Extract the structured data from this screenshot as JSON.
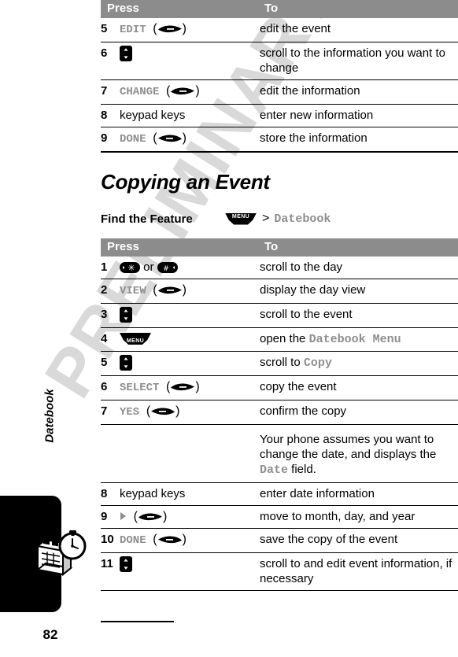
{
  "watermark": {
    "text": "PRELIMINARY",
    "color": "#d9d9d9"
  },
  "sidebar": {
    "chapter_label": "Datebook",
    "tab_icon": "datebook-stopwatch-icon",
    "page_number": "82"
  },
  "table_top": {
    "columns": [
      "Press",
      "To"
    ],
    "rows": [
      {
        "num": "5",
        "press_label": "EDIT",
        "press_key": "right-soft-key",
        "to": "edit the event"
      },
      {
        "num": "6",
        "press_label": "",
        "press_key": "scroll-key",
        "to": "scroll to the information you want to change"
      },
      {
        "num": "7",
        "press_label": "CHANGE",
        "press_key": "right-soft-key",
        "to": "edit the information"
      },
      {
        "num": "8",
        "press_label": "keypad keys",
        "press_key": "none",
        "to": "enter new information"
      },
      {
        "num": "9",
        "press_label": "DONE",
        "press_key": "left-soft-key",
        "to": "store the information"
      }
    ]
  },
  "section": {
    "heading": "Copying an Event",
    "find_the_feature": {
      "label": "Find the Feature",
      "key": "MENU",
      "separator": ">",
      "path": "Datebook"
    }
  },
  "table_main": {
    "columns": [
      "Press",
      "To"
    ],
    "rows": [
      {
        "num": "1",
        "press_label": "",
        "press_key": "star-key-or-pound-key",
        "or_text": "or",
        "to": "scroll to the day"
      },
      {
        "num": "2",
        "press_label": "VIEW",
        "press_key": "right-soft-key",
        "to": "display the day view"
      },
      {
        "num": "3",
        "press_label": "",
        "press_key": "scroll-key",
        "to": "scroll to the event"
      },
      {
        "num": "4",
        "press_label": "",
        "press_key": "menu-key",
        "to_pre": "open the ",
        "to_mono": "Datebook Menu",
        "to_post": ""
      },
      {
        "num": "5",
        "press_label": "",
        "press_key": "scroll-key",
        "to_pre": "scroll to ",
        "to_mono": "Copy",
        "to_post": ""
      },
      {
        "num": "6",
        "press_label": "SELECT",
        "press_key": "right-soft-key",
        "to": "copy the event"
      },
      {
        "num": "7",
        "press_label": "YES",
        "press_key": "left-soft-key",
        "to": "confirm the copy",
        "note_pre": "Your phone assumes you want to change the date, and displays the ",
        "note_mono": "Date",
        "note_post": " field."
      },
      {
        "num": "8",
        "press_label": "keypad keys",
        "press_key": "none",
        "to": "enter date information"
      },
      {
        "num": "9",
        "press_label": "",
        "press_key": "right-arrow-then-right-soft-key",
        "to": "move to month, day, and year"
      },
      {
        "num": "10",
        "press_label": "DONE",
        "press_key": "left-soft-key",
        "to": "save the copy of the event"
      },
      {
        "num": "11",
        "press_label": "",
        "press_key": "scroll-key",
        "to": "scroll to and edit event information, if necessary"
      }
    ]
  }
}
